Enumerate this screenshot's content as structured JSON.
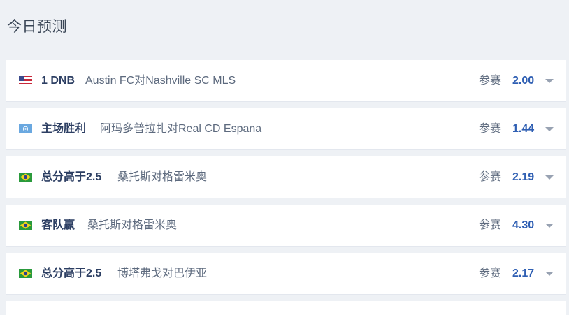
{
  "page": {
    "title": "今日预测"
  },
  "predictions": [
    {
      "flag": "us-flag-icon",
      "bet_type": "1 DNB",
      "match": "Austin FC对Nashville SC MLS",
      "join_label": "参赛",
      "odds": "2.00"
    },
    {
      "flag": "un-flag-icon",
      "bet_type": "主场胜利",
      "match": "阿玛多普拉扎对Real CD Espana",
      "join_label": "参赛",
      "odds": "1.44"
    },
    {
      "flag": "brazil-flag-icon",
      "bet_type": "总分高于2.5",
      "match": "桑托斯对格雷米奥",
      "join_label": "参赛",
      "odds": "2.19"
    },
    {
      "flag": "brazil-flag-icon",
      "bet_type": "客队赢",
      "match": "桑托斯对格雷米奥",
      "join_label": "参赛",
      "odds": "4.30"
    },
    {
      "flag": "brazil-flag-icon",
      "bet_type": "总分高于2.5",
      "match": "博塔弗戈对巴伊亚",
      "join_label": "参赛",
      "odds": "2.17"
    }
  ],
  "colors": {
    "background": "#eef1f5",
    "row": "#ffffff",
    "bet_type": "#2d3f63",
    "odds": "#2f5fb3",
    "muted": "#5d6a7e"
  }
}
